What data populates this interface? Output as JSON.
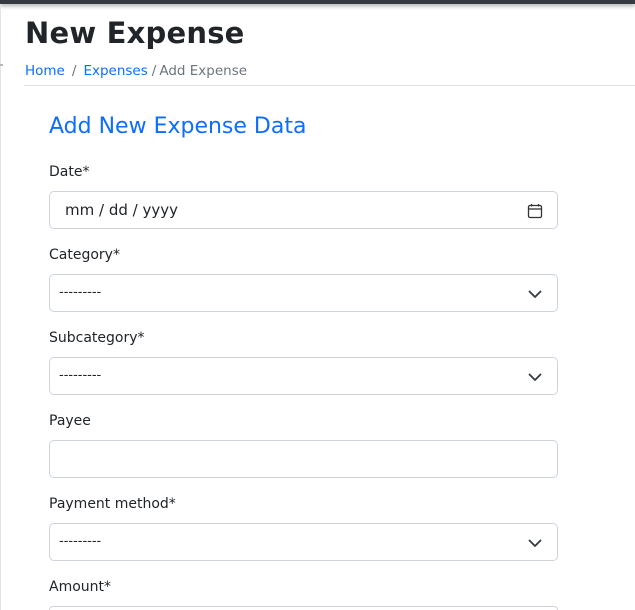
{
  "header": {
    "title": "New Expense",
    "breadcrumb": {
      "home": "Home",
      "separator": "/",
      "expenses": "Expenses",
      "current": "Add Expense"
    }
  },
  "form": {
    "title": "Add New Expense Data",
    "date": {
      "label": "Date*",
      "placeholder": "mm / dd / yyyy",
      "icon": "calendar-icon"
    },
    "category": {
      "label": "Category*",
      "value": "---------",
      "icon": "chevron-down-icon"
    },
    "subcategory": {
      "label": "Subcategory*",
      "value": "---------",
      "icon": "chevron-down-icon"
    },
    "payee": {
      "label": "Payee",
      "value": ""
    },
    "payment_method": {
      "label": "Payment method*",
      "value": "---------",
      "icon": "chevron-down-icon"
    },
    "amount": {
      "label": "Amount*",
      "value": ""
    }
  },
  "colors": {
    "link": "#0d6efd",
    "title": "#212529",
    "muted": "#6c757d",
    "border": "#ced4da",
    "topbar": "#343a40"
  }
}
